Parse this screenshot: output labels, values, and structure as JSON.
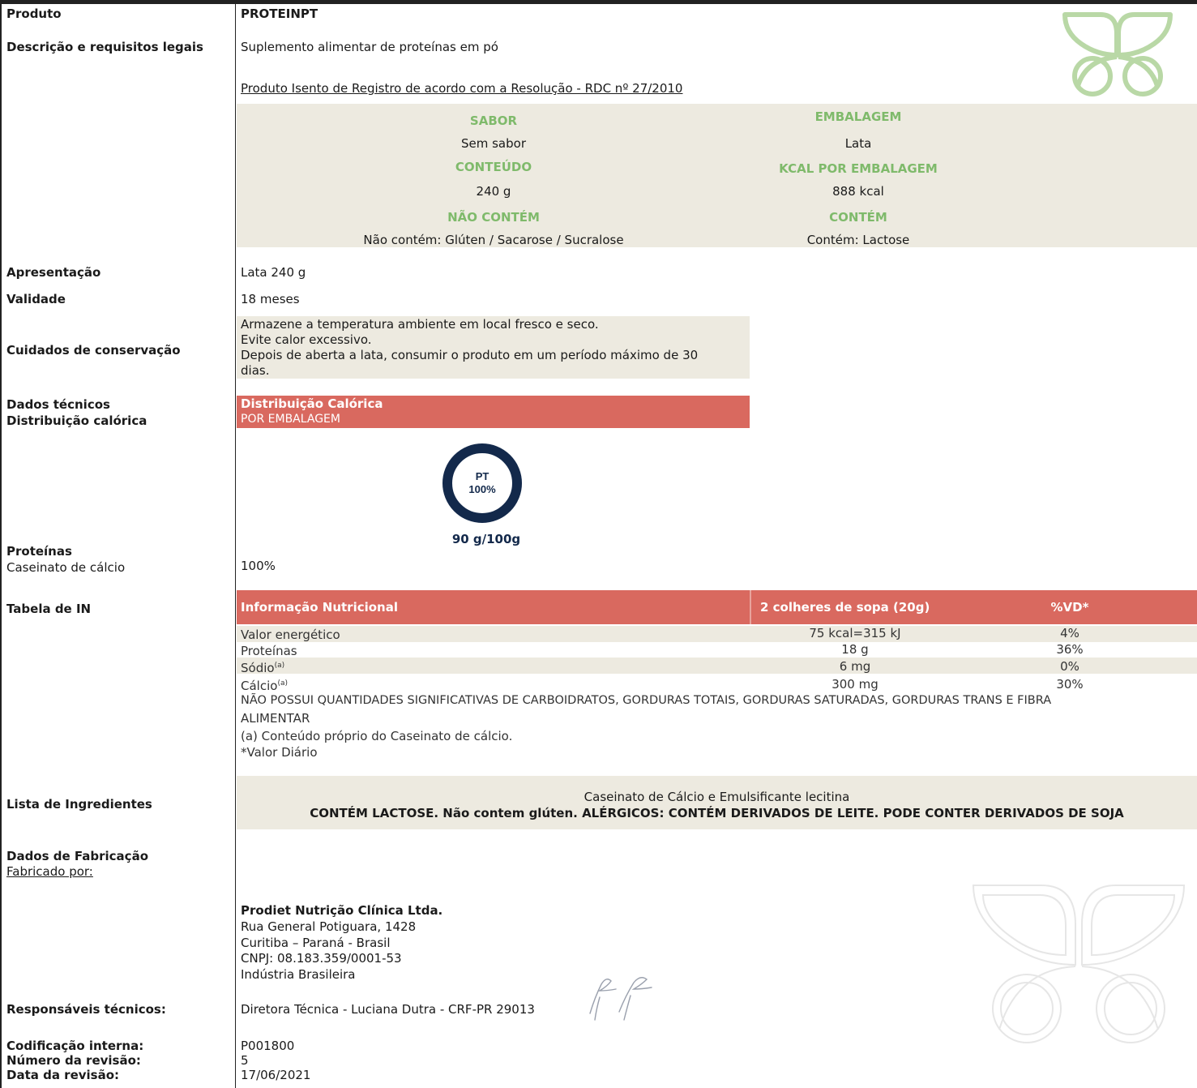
{
  "labels": {
    "produto": "Produto",
    "descricao": "Descrição e requisitos legais",
    "apresentacao": "Apresentação",
    "validade": "Validade",
    "cuidados": "Cuidados de conservação",
    "dados_tecnicos": "Dados técnicos",
    "distribuicao": "Distribuição calórica",
    "proteinas": "Proteínas",
    "caseinato": "Caseinato de cálcio",
    "tabela_in": "Tabela de IN",
    "ingredientes": "Lista de Ingredientes",
    "dados_fabricacao": "Dados de Fabricação",
    "fabricado_por": "Fabricado por:",
    "responsaveis": "Responsáveis técnicos:",
    "codificacao": "Codificação interna:",
    "numero_revisao": "Número da revisão:",
    "data_revisao": "Data da revisão:"
  },
  "values": {
    "produto": "PROTEINPT",
    "descricao": "Suplemento alimentar de proteínas em pó",
    "registro": "Produto Isento de Registro de acordo com a Resolução - RDC nº 27/2010",
    "apresentacao": "Lata 240 g",
    "validade": "18 meses",
    "cuidados": [
      "Armazene a temperatura ambiente em local fresco e seco.",
      "Evite calor excessivo.",
      "Depois de aberta a lata, consumir o produto em um período máximo de 30",
      "dias."
    ],
    "proteinas_pct": "100%",
    "codificacao": "P001800",
    "numero_revisao": "5",
    "data_revisao": "17/06/2021"
  },
  "specs": {
    "sabor_title": "SABOR",
    "sabor": "Sem sabor",
    "embalagem_title": "EMBALAGEM",
    "embalagem": "Lata",
    "conteudo_title": "CONTEÚDO",
    "conteudo": "240 g",
    "kcal_title": "KCAL POR EMBALAGEM",
    "kcal": "888 kcal",
    "nao_contem_title": "NÃO CONTÉM",
    "nao_contem": "Não contém: Glúten / Sacarose / Sucralose",
    "contem_title": "CONTÉM",
    "contem": "Contém: Lactose"
  },
  "caloric": {
    "title": "Distribuição Calórica",
    "subtitle": "POR EMBALAGEM",
    "ring_label": "PT",
    "ring_pct": "100%",
    "ring_fraction": 1.0,
    "amount": "90 g/100g",
    "ring_color": "#13294b"
  },
  "nutrition": {
    "header": [
      "Informação Nutricional",
      "2 colheres de sopa (20g)",
      "%VD*"
    ],
    "rows": [
      {
        "name": "Valor energético",
        "sup": "",
        "qty": "75 kcal=315 kJ",
        "vd": "4%"
      },
      {
        "name": "Proteínas",
        "sup": "",
        "qty": "18 g",
        "vd": "36%"
      },
      {
        "name": "Sódio",
        "sup": "(a)",
        "qty": "6 mg",
        "vd": "0%"
      },
      {
        "name": "Cálcio",
        "sup": "(a)",
        "qty": "300 mg",
        "vd": "30%"
      }
    ],
    "note1": "NÃO POSSUI QUANTIDADES SIGNIFICATIVAS DE CARBOIDRATOS, GORDURAS TOTAIS, GORDURAS SATURADAS, GORDURAS TRANS E FIBRA",
    "note1b": "ALIMENTAR",
    "note2": "(a)  Conteúdo próprio do Caseinato de cálcio.",
    "note3": "*Valor Diário"
  },
  "ingredients": {
    "line1": "Caseinato de Cálcio e Emulsificante lecitina",
    "line2": "CONTÉM LACTOSE. Não contem glúten. ALÉRGICOS: CONTÉM DERIVADOS DE LEITE. PODE CONTER DERIVADOS DE SOJA"
  },
  "manufacturer": {
    "name": "Prodiet Nutrição Clínica Ltda.",
    "address": "Rua General Potiguara, 1428",
    "city": "Curitiba – Paraná - Brasil",
    "cnpj": "CNPJ: 08.183.359/0001-53",
    "origin": "Indústria Brasileira"
  },
  "responsible": "Diretora Técnica - Luciana Dutra - CRF-PR 29013",
  "colors": {
    "accent_green": "#7fba6b",
    "header_red": "#d9695f",
    "beige": "#edeae0",
    "navy": "#13294b"
  }
}
